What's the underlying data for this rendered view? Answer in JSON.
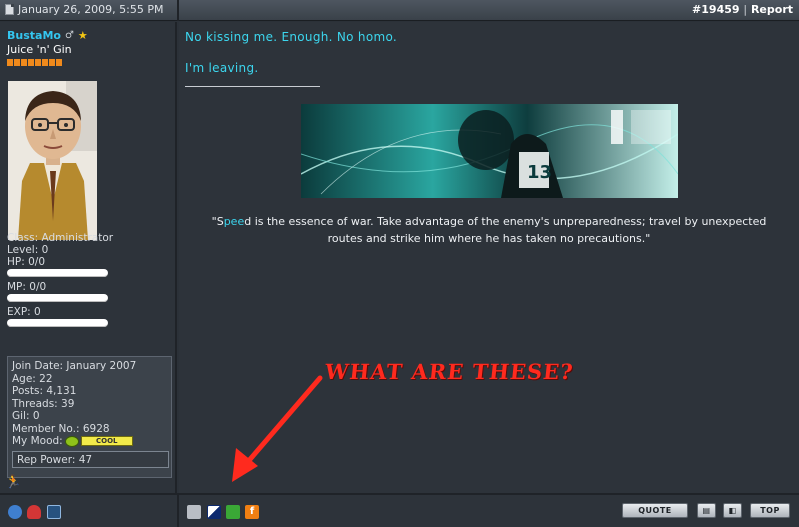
{
  "header": {
    "date": "January 26, 2009, 5:55 PM",
    "post_number": "#19459",
    "separator": "|",
    "report_label": "Report"
  },
  "user": {
    "name": "BustaMo",
    "gender_symbol": "♂",
    "star": "★",
    "title": "Juice 'n' Gin",
    "rep_pips": 8,
    "class_line": "Class: Administrator",
    "level_line": "Level: 0",
    "hp_line": "HP: 0/0",
    "mp_line": "MP: 0/0",
    "exp_line": "EXP: 0",
    "hp_fill": 0,
    "mp_fill": 0,
    "exp_fill": 0,
    "info": {
      "join_date": "Join Date: January 2007",
      "age": "Age: 22",
      "posts": "Posts: 4,131",
      "threads": "Threads: 39",
      "gil": "Gil: 0",
      "member_no": "Member No.: 6928",
      "mood_label": "My Mood:",
      "mood_value": "COOL",
      "rep_power": "Rep Power: 47"
    }
  },
  "post": {
    "line1": "No kissing me. Enough. No homo.",
    "line2": "I'm leaving.",
    "quote_pre": "\"S",
    "quote_hl": "pee",
    "quote_post": "d is the essence of war. Take advantage of the enemy's unpreparedness; travel by unexpected routes and strike him where he has taken no precautions.\""
  },
  "annotation": {
    "text": "WHAT ARE THESE?"
  },
  "footer": {
    "quote_button": "QUOTE",
    "top_button": "TOP"
  },
  "colors": {
    "accent_cyan": "#3cd6ee",
    "username_blue": "#34c6f0",
    "annotation_red": "#ff2a1e",
    "panel_bg": "#2d333a"
  }
}
